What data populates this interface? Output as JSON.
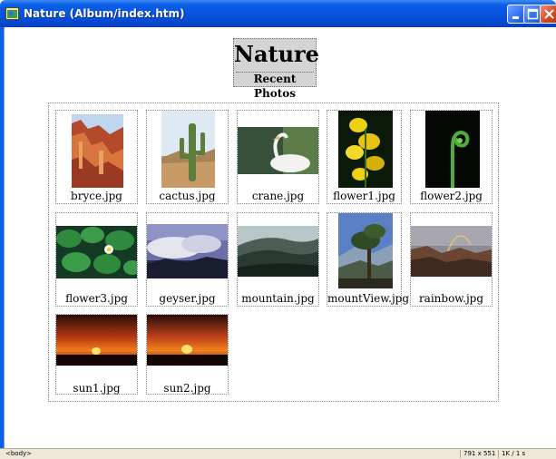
{
  "window": {
    "title": "Nature (Album/index.htm)"
  },
  "page": {
    "title": "Nature",
    "subtitle": "Recent Photos"
  },
  "photos": [
    {
      "file": "bryce.jpg",
      "icon": "canyon-rock-photo"
    },
    {
      "file": "cactus.jpg",
      "icon": "cactus-photo"
    },
    {
      "file": "crane.jpg",
      "icon": "crane-bird-photo"
    },
    {
      "file": "flower1.jpg",
      "icon": "yellow-flower-photo"
    },
    {
      "file": "flower2.jpg",
      "icon": "fern-curl-photo"
    },
    {
      "file": "flower3.jpg",
      "icon": "lily-pads-photo"
    },
    {
      "file": "geyser.jpg",
      "icon": "geyser-photo"
    },
    {
      "file": "mountain.jpg",
      "icon": "mountain-hills-photo"
    },
    {
      "file": "mountView.jpg",
      "icon": "mountain-view-tree-photo"
    },
    {
      "file": "rainbow.jpg",
      "icon": "rainbow-canyon-photo"
    },
    {
      "file": "sun1.jpg",
      "icon": "sunset-photo"
    },
    {
      "file": "sun2.jpg",
      "icon": "sunset-photo"
    }
  ],
  "statusbar": {
    "tag": "<body>",
    "window_size": "791 x 551",
    "download": "1K / 1 s"
  },
  "colors": {
    "titlebar": "#0754e0",
    "statusbar": "#ece9d8",
    "heading_bg": "#d4d4d4"
  }
}
